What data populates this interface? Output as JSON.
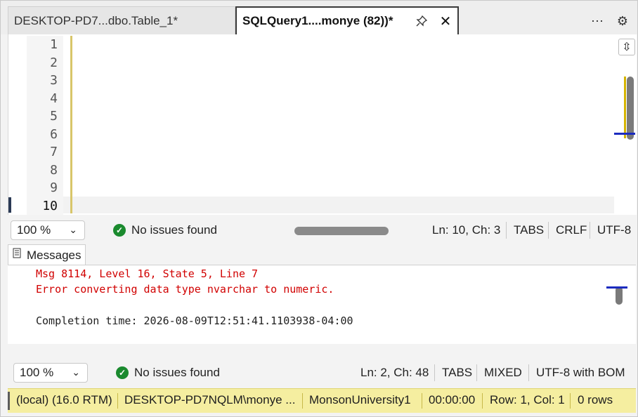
{
  "tabs": [
    {
      "label": "DESKTOP-PD7...dbo.Table_1*"
    },
    {
      "label": "SQLQuery1....monye (82))*"
    }
  ],
  "icons": {
    "pin": "pin-icon",
    "close": "close-icon",
    "more": "more-icon",
    "settings": "gear-icon"
  },
  "editor": {
    "line_numbers": [
      "1",
      "2",
      "3",
      "4",
      "5",
      "6",
      "7",
      "8",
      "9",
      "10"
    ],
    "current_line": "10"
  },
  "editor_status": {
    "zoom": "100 %",
    "issues": "No issues found",
    "position": "Ln: 10, Ch: 3",
    "indent": "TABS",
    "line_ending": "CRLF",
    "encoding": "UTF-8"
  },
  "messages": {
    "tab_label": "Messages",
    "lines": [
      "Msg 8114, Level 16, State 5, Line 7",
      "Error converting data type nvarchar to numeric.",
      "Completion time: 2026-08-09T12:51:41.1103938-04:00"
    ]
  },
  "results_status": {
    "zoom": "100 %",
    "issues": "No issues found",
    "position": "Ln: 2, Ch: 48",
    "indent": "TABS",
    "line_ending": "MIXED",
    "encoding": "UTF-8 with BOM"
  },
  "connection": {
    "server": "(local) (16.0 RTM)",
    "login": "DESKTOP-PD7NQLM\\monye ...",
    "database": "MonsonUniversity1",
    "elapsed": "00:00:00",
    "rowcol": "Row: 1, Col: 1",
    "rows": "0 rows"
  },
  "colors": {
    "keyword": "#e1001b",
    "string": "#c90000",
    "number": "#d6008c",
    "error": "#d10000",
    "connection_bar": "#f5eea0"
  }
}
